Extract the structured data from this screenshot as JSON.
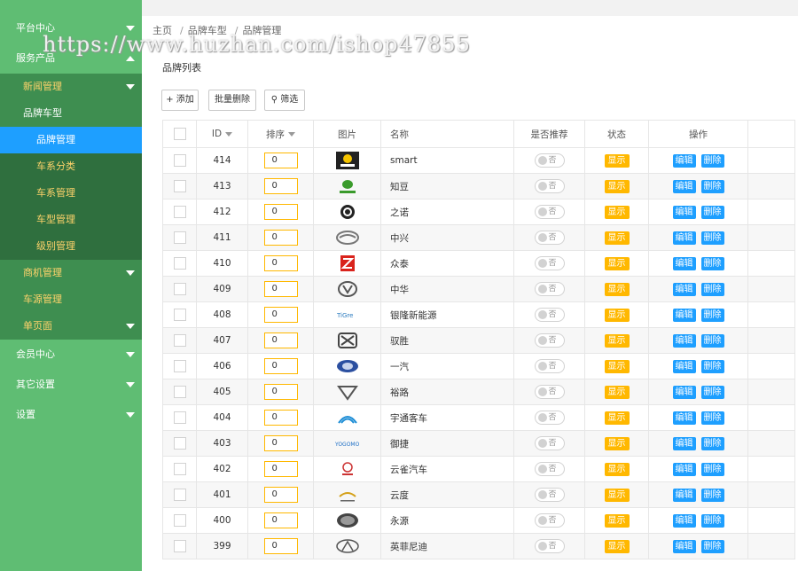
{
  "watermark": "https://www.huzhan.com/ishop47855",
  "sidebar": {
    "platform": "平台中心",
    "service": "服务产品",
    "news": "新闻管理",
    "brand_group": "品牌车型",
    "brand_items": [
      "品牌管理",
      "车系分类",
      "车系管理",
      "车型管理",
      "级别管理"
    ],
    "business": "商机管理",
    "car_source": "车源管理",
    "single_page": "单页面",
    "member": "会员中心",
    "other": "其它设置",
    "settings": "设置"
  },
  "breadcrumb": [
    "主页",
    "品牌车型",
    "品牌管理"
  ],
  "panel_title": "品牌列表",
  "toolbar": {
    "add": "+ 添加",
    "batch_delete": "批量删除",
    "filter": "筛选"
  },
  "table": {
    "headers": {
      "id": "ID",
      "sort": "排序",
      "image": "图片",
      "name": "名称",
      "recommend": "是否推荐",
      "status": "状态",
      "ops": "操作"
    },
    "toggle_text": "否",
    "status_text": "显示",
    "edit_text": "编辑",
    "delete_text": "删除",
    "rows": [
      {
        "id": "414",
        "sort": "0",
        "name": "smart",
        "logo": "smart"
      },
      {
        "id": "413",
        "sort": "0",
        "name": "知豆",
        "logo": "zhidou"
      },
      {
        "id": "412",
        "sort": "0",
        "name": "之诺",
        "logo": "zinoro"
      },
      {
        "id": "411",
        "sort": "0",
        "name": "中兴",
        "logo": "zxauto"
      },
      {
        "id": "410",
        "sort": "0",
        "name": "众泰",
        "logo": "zotye"
      },
      {
        "id": "409",
        "sort": "0",
        "name": "中华",
        "logo": "brilliance"
      },
      {
        "id": "408",
        "sort": "0",
        "name": "银隆新能源",
        "logo": "yinlong"
      },
      {
        "id": "407",
        "sort": "0",
        "name": "驭胜",
        "logo": "yusheng"
      },
      {
        "id": "406",
        "sort": "0",
        "name": "一汽",
        "logo": "faw"
      },
      {
        "id": "405",
        "sort": "0",
        "name": "裕路",
        "logo": "yulu"
      },
      {
        "id": "404",
        "sort": "0",
        "name": "宇通客车",
        "logo": "yutong"
      },
      {
        "id": "403",
        "sort": "0",
        "name": "御捷",
        "logo": "yogomo"
      },
      {
        "id": "402",
        "sort": "0",
        "name": "云雀汽车",
        "logo": "yunque"
      },
      {
        "id": "401",
        "sort": "0",
        "name": "云度",
        "logo": "yundu"
      },
      {
        "id": "400",
        "sort": "0",
        "name": "永源",
        "logo": "yongyuan"
      },
      {
        "id": "399",
        "sort": "0",
        "name": "英菲尼迪",
        "logo": "infiniti"
      }
    ]
  },
  "colors": {
    "sidebar_bg": "#5fbd73",
    "active": "#1e9fff",
    "accent": "#ffb800"
  }
}
